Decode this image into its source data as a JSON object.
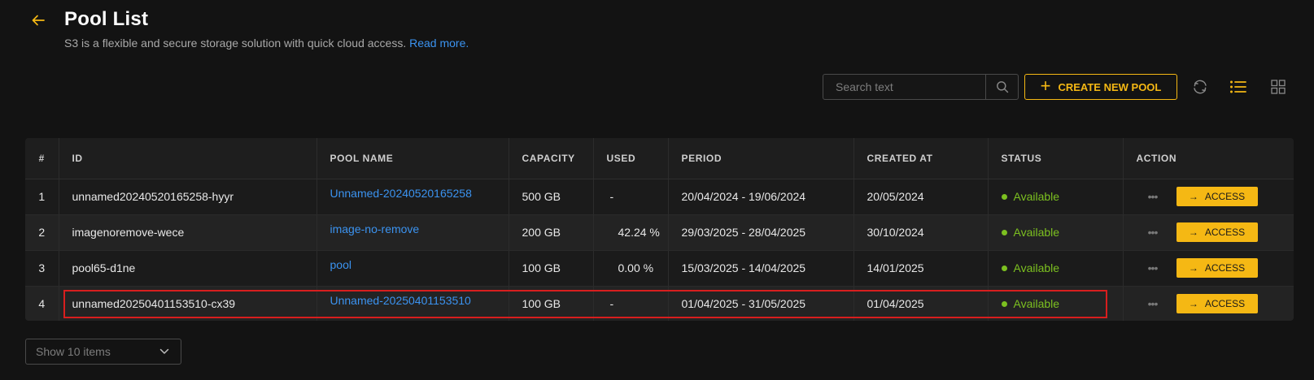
{
  "header": {
    "title": "Pool List",
    "subtitle": "S3 is a flexible and secure storage solution with quick cloud access.",
    "read_more": "Read more."
  },
  "toolbar": {
    "search_placeholder": "Search text",
    "create_label": "CREATE NEW POOL"
  },
  "table": {
    "columns": [
      "#",
      "ID",
      "POOL NAME",
      "CAPACITY",
      "USED",
      "PERIOD",
      "CREATED AT",
      "STATUS",
      "ACTION"
    ],
    "rows": [
      {
        "num": "1",
        "id": "unnamed20240520165258-hyyr",
        "pool_name": "Unnamed-20240520165258",
        "capacity": "500 GB",
        "used": "-",
        "period": "20/04/2024 - 19/06/2024",
        "created_at": "20/05/2024",
        "status": "Available",
        "action": "ACCESS",
        "more": "•••"
      },
      {
        "num": "2",
        "id": "imagenoremove-wece",
        "pool_name": "image-no-remove",
        "capacity": "200 GB",
        "used": "42.24 %",
        "period": "29/03/2025 - 28/04/2025",
        "created_at": "30/10/2024",
        "status": "Available",
        "action": "ACCESS",
        "more": "•••"
      },
      {
        "num": "3",
        "id": "pool65-d1ne",
        "pool_name": "pool",
        "capacity": "100 GB",
        "used": "0.00 %",
        "period": "15/03/2025 - 14/04/2025",
        "created_at": "14/01/2025",
        "status": "Available",
        "action": "ACCESS",
        "more": "•••"
      },
      {
        "num": "4",
        "id": "unnamed20250401153510-cx39",
        "pool_name": "Unnamed-20250401153510",
        "capacity": "100 GB",
        "used": "-",
        "period": "01/04/2025 - 31/05/2025",
        "created_at": "01/04/2025",
        "status": "Available",
        "action": "ACCESS",
        "more": "•••"
      }
    ]
  },
  "pagination": {
    "page_size_label": "Show 10 items"
  },
  "colors": {
    "accent": "#f5b814",
    "link": "#3b93f0",
    "status_available": "#7cc020",
    "background": "#131313",
    "highlight": "#d81e1e"
  },
  "icons": [
    "arrow-left-icon",
    "search-icon",
    "plus-icon",
    "refresh-icon",
    "list-view-icon",
    "grid-view-icon",
    "more-icon",
    "arrow-right-icon",
    "chevron-down-icon"
  ]
}
